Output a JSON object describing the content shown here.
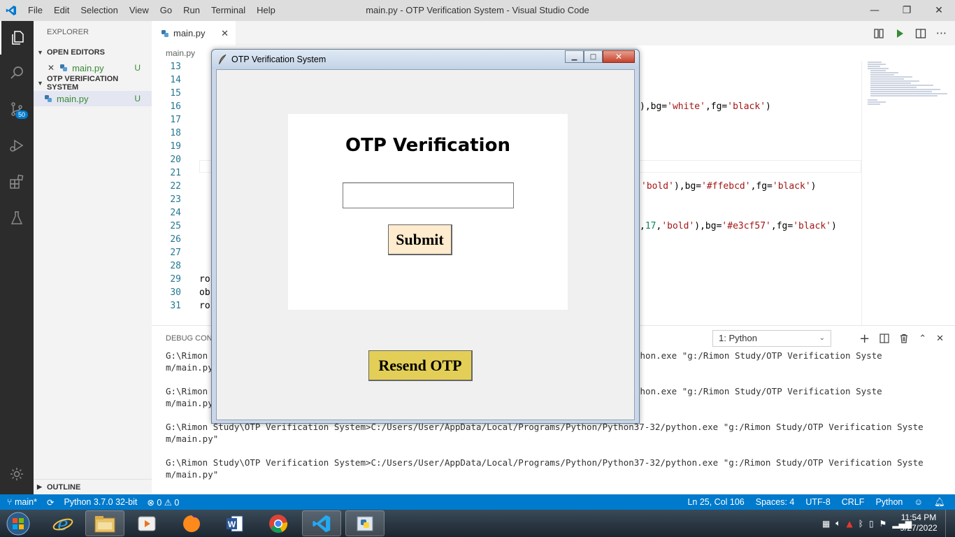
{
  "window": {
    "title": "main.py - OTP Verification System - Visual Studio Code",
    "menu": [
      "File",
      "Edit",
      "Selection",
      "View",
      "Go",
      "Run",
      "Terminal",
      "Help"
    ]
  },
  "activity_bar": {
    "scm_badge": "50"
  },
  "sidebar": {
    "title": "EXPLORER",
    "open_editors_label": "OPEN EDITORS",
    "open_editor_file": "main.py",
    "open_editor_status": "U",
    "project_label": "OTP VERIFICATION SYSTEM",
    "project_file": "main.py",
    "project_file_status": "U",
    "outline_label": "OUTLINE"
  },
  "editor": {
    "tab_label": "main.py",
    "breadcrumb": "main.py",
    "line_numbers": [
      "13",
      "14",
      "15",
      "16",
      "17",
      "18",
      "19",
      "20",
      "21",
      "22",
      "23",
      "24",
      "25",
      "26",
      "27",
      "28",
      "29",
      "30",
      "31"
    ],
    "code_line_16": {
      "pre": "),bg=",
      "s1": "'white'",
      "mid": ",fg=",
      "s2": "'black'",
      "post": ")"
    },
    "code_line_22": {
      "s0": "'bold'",
      "pre": "),bg=",
      "s1": "'#ffebcd'",
      "mid": ",fg=",
      "s2": "'black'",
      "post": ")"
    },
    "code_line_25": {
      "pre": ",",
      "num": "17",
      "c1": ",",
      "s0": "'bold'",
      "c2": "),bg=",
      "s1": "'#e3cf57'",
      "mid": ",fg=",
      "s2": "'black'",
      "post": ")"
    },
    "code_line_29": "ro",
    "code_line_30": "ob",
    "code_line_31": "ro"
  },
  "panel": {
    "title": "DEBUG CONS",
    "terminal_select": "1: Python",
    "terminal_lines": [
      "G:\\Rimon",
      "m/main.py",
      "G:\\Rimon",
      "m/main.py",
      "G:\\Rimon Study\\OTP Verification System>C:/Users/User/AppData/Local/Programs/Python/Python37-32/python.exe \"g:/Rimon Study/OTP Verification Syste",
      "m/main.py\"",
      "G:\\Rimon Study\\OTP Verification System>C:/Users/User/AppData/Local/Programs/Python/Python37-32/python.exe \"g:/Rimon Study/OTP Verification Syste",
      "m/main.py\""
    ],
    "hidden_tail_1": "thon.exe \"g:/Rimon Study/OTP Verification Syste",
    "hidden_tail_2": "thon.exe \"g:/Rimon Study/OTP Verification Syste"
  },
  "statusbar": {
    "branch": "main*",
    "interpreter": "Python 3.7.0 32-bit",
    "problems": "⊗ 0 ⚠ 0",
    "position": "Ln 25, Col 106",
    "spaces": "Spaces: 4",
    "encoding": "UTF-8",
    "eol": "CRLF",
    "language": "Python"
  },
  "taskbar": {
    "time": "11:54 PM",
    "date": "9/27/2022"
  },
  "otp_window": {
    "title": "OTP Verification System",
    "heading": "OTP Verification",
    "input_value": "",
    "submit_label": "Submit",
    "resend_label": "Resend OTP",
    "colors": {
      "frame_bg": "#ffffff",
      "submit_bg": "#ffebcd",
      "resend_bg": "#e3cf57"
    }
  }
}
